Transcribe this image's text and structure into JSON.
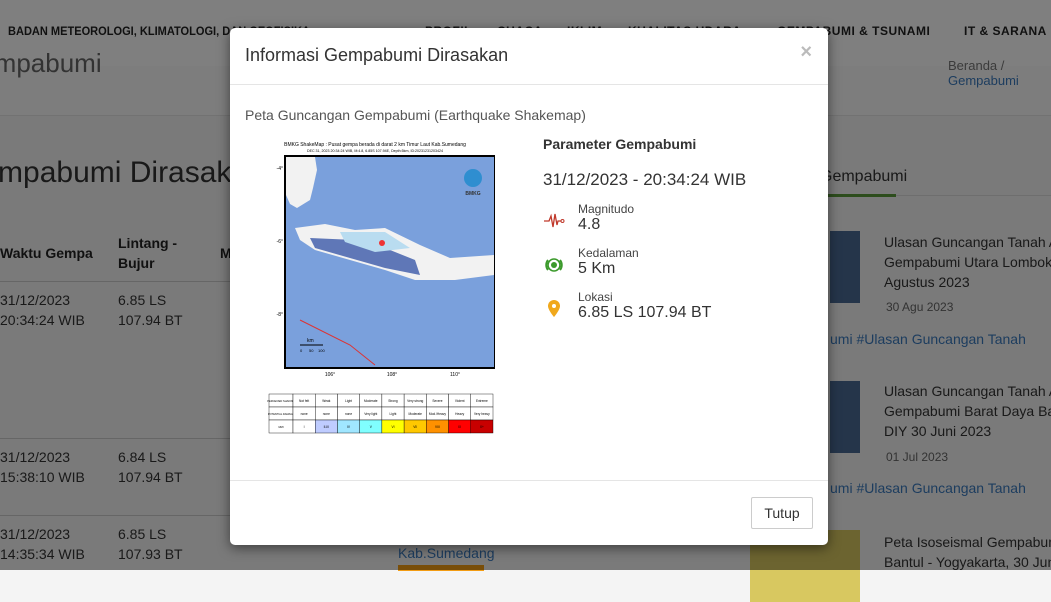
{
  "header": {
    "brand": "BADAN METEOROLOGI, KLIMATOLOGI, DAN GEOFISIKA",
    "nav": [
      "PROFIL",
      "CUACA",
      "IKLIM",
      "KUALITAS UDARA",
      "GEMPABUMI & TSUNAMI",
      "IT & SARANA"
    ]
  },
  "page": {
    "title": "Gempabumi",
    "breadcrumb_home": "Beranda",
    "breadcrumb_sep": "/",
    "breadcrumb_current": "Gempabumi",
    "heading": "Gempabumi Dirasakan"
  },
  "table": {
    "headers": [
      "Waktu Gempa",
      "Lintang - Bujur",
      "M"
    ],
    "rows": [
      {
        "date": "31/12/2023",
        "time": "20:34:24 WIB",
        "lat": "6.85 LS",
        "lon": "107.94 BT"
      },
      {
        "date": "31/12/2023",
        "time": "15:38:10 WIB",
        "lat": "6.84 LS",
        "lon": "107.94 BT"
      },
      {
        "date": "31/12/2023",
        "time": "14:35:34 WIB",
        "lat": "6.85 LS",
        "lon": "107.93 BT"
      }
    ],
    "link": "Kab.Sumedang"
  },
  "sidebar": {
    "tab": "Gempabumi",
    "cards": [
      {
        "title1": "Ulasan Guncangan Tanah A",
        "title2": "Gempabumi Utara Lombok",
        "title3": "Agustus 2023",
        "date": "30 Agu 2023",
        "tags": "umi #Ulasan Guncangan Tanah"
      },
      {
        "title1": "Ulasan Guncangan Tanah A",
        "title2": "Gempabumi Barat Daya Ba",
        "title3": "DIY 30 Juni 2023",
        "date": "01 Jul 2023",
        "tags": "umi #Ulasan Guncangan Tanah"
      },
      {
        "title1": "Peta Isoseismal Gempabum",
        "title2": "Bantul - Yogyakarta, 30 Jun"
      }
    ]
  },
  "modal": {
    "title": "Informasi Gempabumi Dirasakan",
    "close": "×",
    "subtitle": "Peta Guncangan Gempabumi (Earthquake Shakemap)",
    "map": {
      "title": "BMKG ShakeMap : Pusat gempa berada di darat 2 km Timur Laut Kab.Sumedang",
      "subtitle": "DEC 31, 2023 20:34:24 WIB, M:4.8, 6.85S 107.94E, Depth:5km, ID:20231231203424",
      "logo": "BMKG",
      "lon_ticks": [
        "106°",
        "108°",
        "110°"
      ],
      "lat_ticks": [
        "-4°",
        "-6°",
        "-8°"
      ],
      "scale": "km",
      "scale_ticks": [
        "0",
        "50",
        "100"
      ],
      "legend": {
        "rows": [
          "PERCEIVED SHAKING",
          "POTENTIAL DAMAGE",
          "MMI"
        ],
        "shaking": [
          "Not felt",
          "Weak",
          "Light",
          "Moderate",
          "Strong",
          "Very strong",
          "Severe",
          "Violent",
          "Extreme"
        ],
        "damage": [
          "none",
          "none",
          "none",
          "Very light",
          "Light",
          "Moderate",
          "Mod./Heavy",
          "Heavy",
          "Very heavy"
        ],
        "mmi": [
          "I",
          "II-III",
          "IV",
          "V",
          "VI",
          "VII",
          "VIII",
          "IX",
          "X+"
        ],
        "colors": [
          "#ffffff",
          "#bfccff",
          "#a0e6ff",
          "#80ffff",
          "#ffff00",
          "#ffc800",
          "#ff9100",
          "#ff0000",
          "#c80000"
        ]
      }
    },
    "params": {
      "heading": "Parameter Gempabumi",
      "datetime": "31/12/2023 - 20:34:24 WIB",
      "magnitude_label": "Magnitudo",
      "magnitude": "4.8",
      "depth_label": "Kedalaman",
      "depth": "5 Km",
      "location_label": "Lokasi",
      "location": "6.85 LS 107.94 BT"
    },
    "close_button": "Tutup"
  },
  "colors": {
    "magnitude_icon": "#c0392b",
    "depth_icon": "#3c9a2c",
    "location_icon": "#f0a81c",
    "link": "#3b7bbf"
  }
}
